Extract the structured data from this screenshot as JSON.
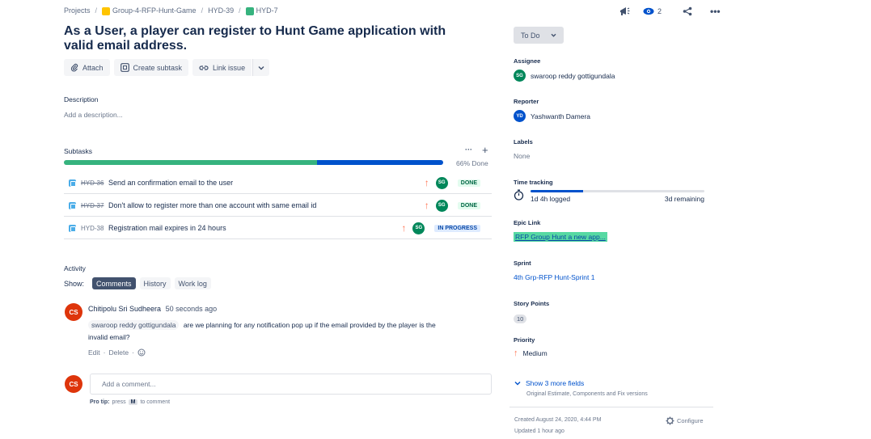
{
  "breadcrumb": {
    "projects": "Projects",
    "project": "Group-4-RFP-Hunt-Game",
    "parent": "HYD-39",
    "epic": "HYD-7"
  },
  "header": {
    "watch_count": "2",
    "icons": [
      "megaphone-icon",
      "eye-icon",
      "share-icon",
      "more-icon"
    ]
  },
  "issue": {
    "title": "As a User, a player can register to Hunt Game application with valid email address."
  },
  "actions": {
    "attach": "Attach",
    "create_subtask": "Create subtask",
    "link_issue": "Link issue"
  },
  "description": {
    "label": "Description",
    "placeholder": "Add a description..."
  },
  "subtasks": {
    "label": "Subtasks",
    "percent_text": "66% Done",
    "done_fraction": 0.667,
    "in_progress_fraction": 0.333,
    "items": [
      {
        "key": "HYD-36",
        "summary": "Send an confirmation email to the user",
        "assignee": "SG",
        "status": "DONE"
      },
      {
        "key": "HYD-37",
        "summary": "Don't allow to register more than one account with same email id",
        "assignee": "SG",
        "status": "DONE"
      },
      {
        "key": "HYD-38",
        "summary": "Registration mail expires in 24 hours",
        "assignee": "SG",
        "status": "IN PROGRESS"
      }
    ]
  },
  "activity": {
    "label": "Activity",
    "show": "Show:",
    "tabs": {
      "comments": "Comments",
      "history": "History",
      "worklog": "Work log"
    },
    "comment": {
      "avatar": "CS",
      "author": "Chitipolu Sri Sudheera",
      "time": "50 seconds ago",
      "mention": "swaroop reddy gottigundala",
      "text_line1": "are we planning for any notification pop up if the email provided by the player  is the",
      "text_line2": "invalid email?",
      "edit": "Edit",
      "delete": "Delete"
    },
    "new_comment": {
      "avatar": "CS",
      "placeholder": "Add a comment...",
      "protip_bold": "Pro tip:",
      "protip_press": "press",
      "protip_key": "M",
      "protip_rest": "to comment"
    }
  },
  "sidebar": {
    "status": "To Do",
    "assignee_label": "Assignee",
    "assignee_avatar": "SG",
    "assignee": "swaroop reddy gottigundala",
    "reporter_label": "Reporter",
    "reporter_avatar": "YD",
    "reporter": "Yashwanth Damera",
    "labels_label": "Labels",
    "labels_value": "None",
    "time_label": "Time tracking",
    "time_logged": "1d 4h logged",
    "time_remaining": "3d remaining",
    "time_fraction": 0.3,
    "epic_label": "Epic Link",
    "epic_value": "RFP Group Hunt a new app...",
    "sprint_label": "Sprint",
    "sprint_value": "4th Grp-RFP Hunt-Sprint 1",
    "points_label": "Story Points",
    "points_value": "10",
    "priority_label": "Priority",
    "priority_value": "Medium",
    "more_fields": "Show 3 more fields",
    "more_fields_sub": "Original Estimate, Components and Fix versions",
    "created": "Created August 24, 2020, 4:44 PM",
    "updated": "Updated 1 hour ago",
    "configure": "Configure"
  },
  "colors": {
    "done": "#36b37e",
    "in_progress": "#0052cc",
    "avatar_sg": "#00875a",
    "avatar_cs": "#de350b",
    "avatar_yd": "#0052cc",
    "epic": "#57d9a3"
  }
}
